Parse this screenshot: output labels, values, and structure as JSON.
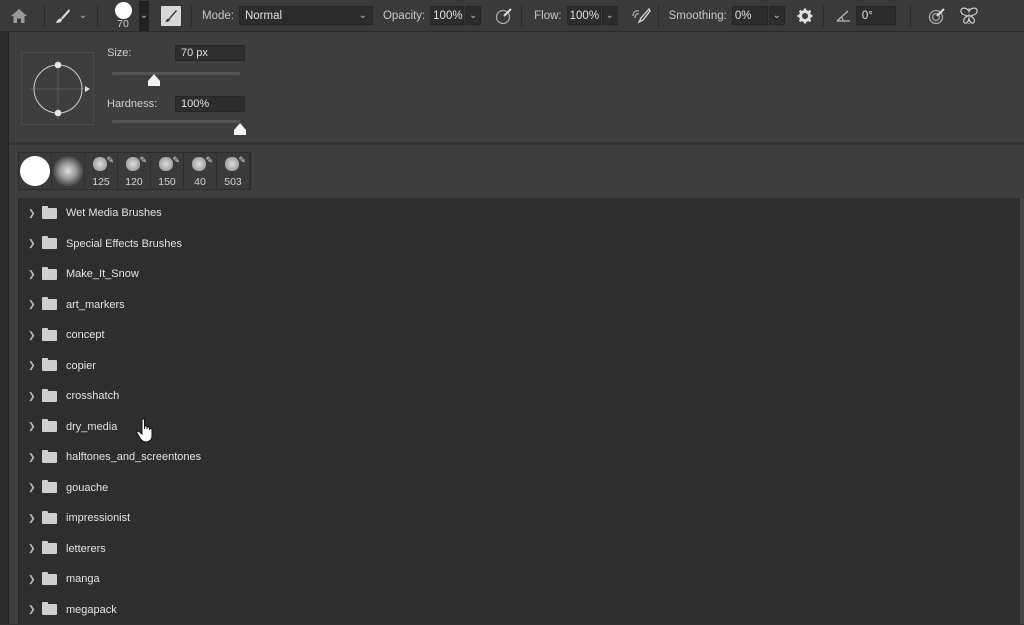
{
  "options_bar": {
    "brush_size_value": "70",
    "mode_label": "Mode:",
    "mode_value": "Normal",
    "opacity_label": "Opacity:",
    "opacity_value": "100%",
    "flow_label": "Flow:",
    "flow_value": "100%",
    "smoothing_label": "Smoothing:",
    "smoothing_value": "0%",
    "angle_value": "0°",
    "icons": [
      "home-icon",
      "brush-tool-icon",
      "brush-panel-toggle-icon",
      "pressure-opacity-icon",
      "airbrush-icon",
      "smoothing-settings-gear-icon",
      "angle-icon",
      "pressure-size-icon",
      "symmetry-butterfly-icon"
    ]
  },
  "brush_picker": {
    "size_label": "Size:",
    "size_value": "70 px",
    "size_slider_fraction": 0.33,
    "hardness_label": "Hardness:",
    "hardness_value": "100%",
    "hardness_slider_fraction": 1.0,
    "recent_brushes": [
      {
        "type": "hard-round",
        "size": ""
      },
      {
        "type": "soft-round",
        "size": ""
      },
      {
        "type": "textured",
        "size": "125"
      },
      {
        "type": "textured",
        "size": "120"
      },
      {
        "type": "textured",
        "size": "150"
      },
      {
        "type": "textured",
        "size": "40"
      },
      {
        "type": "scatter",
        "size": "503"
      }
    ],
    "folders": [
      "Wet Media Brushes",
      "Special Effects Brushes",
      "Make_It_Snow",
      "art_markers",
      "concept",
      "copier",
      "crosshatch",
      "dry_media",
      "halftones_and_screentones",
      "gouache",
      "impressionist",
      "letterers",
      "manga",
      "megapack"
    ]
  }
}
